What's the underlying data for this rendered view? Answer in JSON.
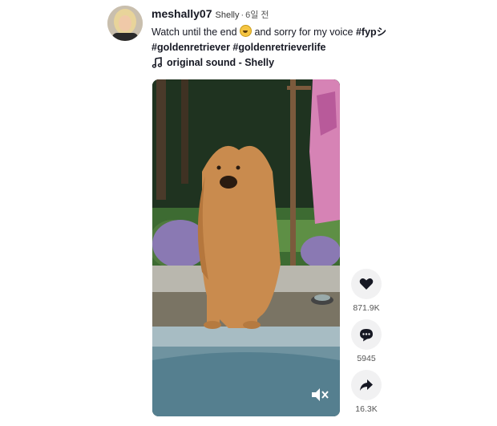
{
  "post": {
    "username": "meshally07",
    "nickname": "Shelly",
    "separator": "·",
    "time": "6일 전",
    "caption_text": "Watch until the end",
    "caption_text_2": "and sorry for my voice",
    "hashtags_line1": "#fypシ",
    "hashtags_line2": "#goldenretriever #goldenretrieverlife",
    "music": "original sound - Shelly",
    "emoji": "grinning-sweat-face"
  },
  "actions": {
    "like_count": "871.9K",
    "comment_count": "5945",
    "share_count": "16.3K"
  },
  "icons": {
    "like": "heart-icon",
    "comment": "comment-bubble-icon",
    "share": "share-arrow-icon",
    "music": "music-note-icon",
    "mute": "muted-speaker-icon"
  },
  "colors": {
    "text": "#161823",
    "muted": "#555555",
    "action_bg": "#f1f1f2"
  }
}
